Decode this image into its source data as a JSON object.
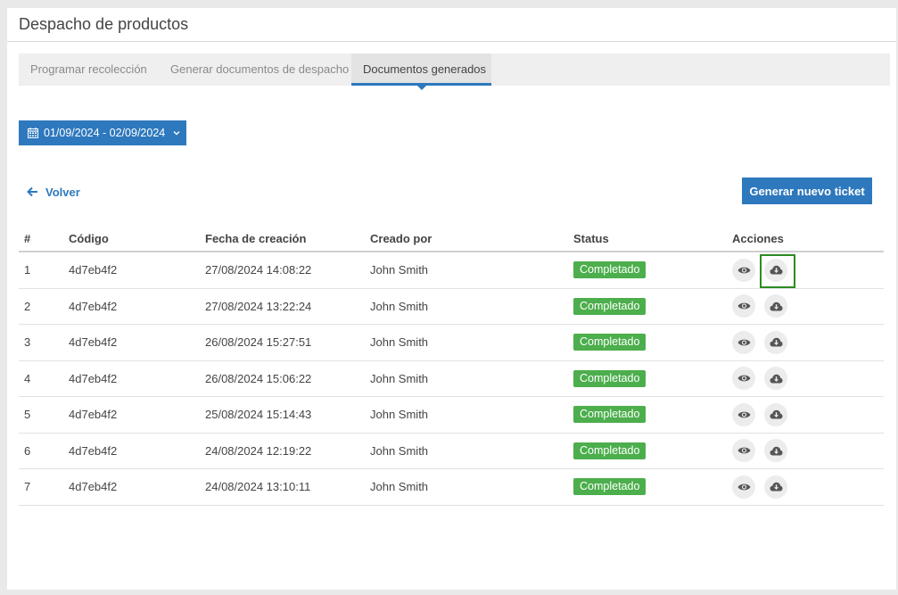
{
  "header": {
    "title": "Despacho de productos"
  },
  "tabs": [
    {
      "label": "Programar recolección"
    },
    {
      "label": "Generar documentos de despacho"
    },
    {
      "label": "Documentos generados"
    }
  ],
  "date_range": {
    "label": "01/09/2024 - 02/09/2024",
    "icon": "calendar-icon"
  },
  "back": {
    "label": "Volver",
    "icon": "arrow-left-icon"
  },
  "new_ticket": {
    "label": "Generar nuevo ticket"
  },
  "table": {
    "headers": [
      "#",
      "Código",
      "Fecha de creación",
      "Creado por",
      "Status",
      "Acciones"
    ],
    "rows": [
      {
        "num": "1",
        "code": "4d7eb4f2",
        "date": "27/08/2024 14:08:22",
        "by": "John Smith",
        "status": "Completado"
      },
      {
        "num": "2",
        "code": "4d7eb4f2",
        "date": "27/08/2024 13:22:24",
        "by": "John Smith",
        "status": "Completado"
      },
      {
        "num": "3",
        "code": "4d7eb4f2",
        "date": "26/08/2024 15:27:51",
        "by": "John Smith",
        "status": "Completado"
      },
      {
        "num": "4",
        "code": "4d7eb4f2",
        "date": "26/08/2024 15:06:22",
        "by": "John Smith",
        "status": "Completado"
      },
      {
        "num": "5",
        "code": "4d7eb4f2",
        "date": "25/08/2024 15:14:43",
        "by": "John Smith",
        "status": "Completado"
      },
      {
        "num": "6",
        "code": "4d7eb4f2",
        "date": "24/08/2024 12:19:22",
        "by": "John Smith",
        "status": "Completado"
      },
      {
        "num": "7",
        "code": "4d7eb4f2",
        "date": "24/08/2024 13:10:11",
        "by": "John Smith",
        "status": "Completado"
      }
    ]
  },
  "colors": {
    "primary": "#2e78bd",
    "success": "#4cae4c",
    "highlight": "#2e8b22"
  }
}
